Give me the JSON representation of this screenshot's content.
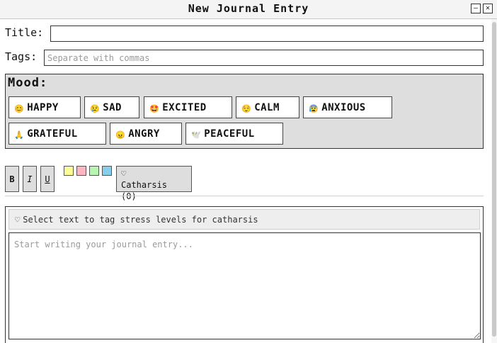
{
  "window": {
    "title": "New Journal Entry",
    "minimize_label": "–",
    "close_label": "✕"
  },
  "form": {
    "title_label": "Title:",
    "title_value": "",
    "tags_label": "Tags:",
    "tags_value": "",
    "tags_placeholder": "Separate with commas"
  },
  "mood": {
    "heading": "Mood:",
    "options": [
      {
        "emoji": "😊",
        "label": "HAPPY"
      },
      {
        "emoji": "😢",
        "label": "SAD"
      },
      {
        "emoji": "🤩",
        "label": "EXCITED"
      },
      {
        "emoji": "😌",
        "label": "CALM"
      },
      {
        "emoji": "😰",
        "label": "ANXIOUS"
      },
      {
        "emoji": "🙏",
        "label": "GRATEFUL"
      },
      {
        "emoji": "😠",
        "label": "ANGRY"
      },
      {
        "emoji": "🕊️",
        "label": "PEACEFUL"
      }
    ]
  },
  "toolbar": {
    "bold_label": "B",
    "italic_label": "I",
    "underline_label": "U",
    "highlight_colors": [
      "#ffff99",
      "#ffb6c1",
      "#b8f5b0",
      "#87ceeb"
    ],
    "catharsis_icon": "♡",
    "catharsis_label": "Catharsis (0)"
  },
  "editor": {
    "hint_icon": "♡",
    "hint_text": "Select text to tag stress levels for catharsis",
    "entry_placeholder": "Start writing your journal entry...",
    "entry_value": ""
  }
}
